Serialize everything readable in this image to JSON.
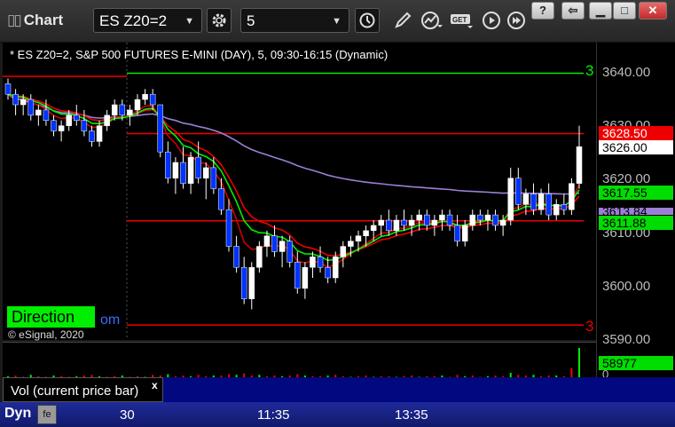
{
  "app": {
    "title": "Chart"
  },
  "toolbar": {
    "symbol": "ES Z20=2",
    "interval": "5",
    "buttons": [
      "settings-icon",
      "clock-icon",
      "pencil-icon",
      "study-icon",
      "get-icon",
      "play-icon",
      "forward-icon"
    ],
    "window": {
      "restore": "?",
      "dock": "⇦",
      "minimize": "▁",
      "maximize": "□",
      "close": "✕"
    }
  },
  "chart": {
    "title": "* ES Z20=2, S&P 500 FUTURES E-MINI (DAY), 5, 09:30-16:15 (Dynamic)",
    "direction_label": "Direction",
    "ghost_label": "om",
    "copyright": "© eSignal, 2020",
    "level_label_top": "3",
    "level_label_bottom": "3",
    "colors": {
      "bg": "#000000",
      "up": "#ffffff",
      "down": "#0033ff",
      "green": "#00ee00",
      "red": "#ee0000",
      "vwap": "#9b7fd6"
    }
  },
  "price_axis": {
    "ticks": [
      "3640.00",
      "3630.00",
      "3620.00",
      "3610.00",
      "3600.00",
      "3590.00"
    ],
    "tags": [
      {
        "text": "3628.50",
        "bg": "#ee0000",
        "fg": "#ffffff"
      },
      {
        "text": "3626.00",
        "bg": "#ffffff",
        "fg": "#000000"
      },
      {
        "text": "3617.55",
        "bg": "#00dd00",
        "fg": "#000000"
      },
      {
        "text": "3613.84",
        "bg": "#9b7fd6",
        "fg": "#000000"
      },
      {
        "text": "3611.88",
        "bg": "#00dd00",
        "fg": "#000000"
      }
    ],
    "hidden_tick": "3610.00"
  },
  "volume": {
    "label": "Vol (current price bar)",
    "close": "x",
    "tag": "58977",
    "zero": "0"
  },
  "time_axis": {
    "labels": [
      "30",
      "11:35",
      "13:35"
    ],
    "dyn": "Dyn",
    "dyn_btn": "fe"
  },
  "chart_data": {
    "type": "candlestick",
    "y_range": [
      3590,
      3645
    ],
    "levels": [
      {
        "name": "green-level",
        "y": 3640.0
      },
      {
        "name": "red-level-upper",
        "y": 3628.5
      },
      {
        "name": "red-level-mid",
        "y": 3611.88
      },
      {
        "name": "red-level-lower",
        "y": 3592.0
      }
    ],
    "candles": [
      [
        3638,
        3639,
        3635,
        3636
      ],
      [
        3636,
        3637,
        3632,
        3634
      ],
      [
        3634,
        3636,
        3632,
        3635
      ],
      [
        3635,
        3636,
        3631,
        3632
      ],
      [
        3632,
        3634,
        3630,
        3633
      ],
      [
        3633,
        3635,
        3630,
        3631
      ],
      [
        3631,
        3632,
        3628,
        3629
      ],
      [
        3629,
        3631,
        3627,
        3630
      ],
      [
        3630,
        3633,
        3629,
        3632
      ],
      [
        3632,
        3634,
        3630,
        3631
      ],
      [
        3631,
        3633,
        3628,
        3629
      ],
      [
        3629,
        3630,
        3626,
        3627
      ],
      [
        3627,
        3631,
        3626,
        3630
      ],
      [
        3630,
        3633,
        3629,
        3632
      ],
      [
        3632,
        3635,
        3631,
        3634
      ],
      [
        3634,
        3635,
        3631,
        3632
      ],
      [
        3632,
        3634,
        3630,
        3633
      ],
      [
        3633,
        3636,
        3632,
        3635
      ],
      [
        3635,
        3637,
        3634,
        3636
      ],
      [
        3636,
        3637,
        3633,
        3634
      ],
      [
        3634,
        3629,
        3624,
        3625
      ],
      [
        3625,
        3627,
        3619,
        3620
      ],
      [
        3620,
        3624,
        3617,
        3623
      ],
      [
        3623,
        3626,
        3618,
        3619
      ],
      [
        3619,
        3625,
        3617,
        3624
      ],
      [
        3624,
        3627,
        3619,
        3620
      ],
      [
        3620,
        3623,
        3616,
        3622
      ],
      [
        3622,
        3624,
        3617,
        3618
      ],
      [
        3618,
        3620,
        3613,
        3614
      ],
      [
        3614,
        3616,
        3606,
        3607
      ],
      [
        3607,
        3609,
        3602,
        3603
      ],
      [
        3603,
        3605,
        3596,
        3597
      ],
      [
        3597,
        3604,
        3595,
        3603
      ],
      [
        3603,
        3608,
        3602,
        3607
      ],
      [
        3607,
        3610,
        3605,
        3609
      ],
      [
        3609,
        3611,
        3605,
        3606
      ],
      [
        3606,
        3609,
        3603,
        3608
      ],
      [
        3608,
        3609,
        3603,
        3604
      ],
      [
        3604,
        3606,
        3598,
        3599
      ],
      [
        3599,
        3604,
        3597,
        3603
      ],
      [
        3603,
        3606,
        3601,
        3605
      ],
      [
        3605,
        3607,
        3602,
        3603
      ],
      [
        3603,
        3605,
        3600,
        3601
      ],
      [
        3601,
        3606,
        3600,
        3605
      ],
      [
        3605,
        3608,
        3603,
        3607
      ],
      [
        3607,
        3609,
        3605,
        3608
      ],
      [
        3608,
        3610,
        3606,
        3609
      ],
      [
        3609,
        3611,
        3607,
        3610
      ],
      [
        3610,
        3612,
        3608,
        3611
      ],
      [
        3611,
        3613,
        3609,
        3612
      ],
      [
        3612,
        3614,
        3609,
        3610
      ],
      [
        3610,
        3613,
        3609,
        3612
      ],
      [
        3612,
        3614,
        3610,
        3611
      ],
      [
        3611,
        3613,
        3609,
        3612
      ],
      [
        3612,
        3614,
        3610,
        3613
      ],
      [
        3613,
        3614,
        3610,
        3611
      ],
      [
        3611,
        3613,
        3609,
        3612
      ],
      [
        3612,
        3614,
        3610,
        3613
      ],
      [
        3613,
        3614,
        3610,
        3611
      ],
      [
        3611,
        3613,
        3607,
        3608
      ],
      [
        3608,
        3612,
        3607,
        3611
      ],
      [
        3611,
        3614,
        3610,
        3613
      ],
      [
        3613,
        3614,
        3611,
        3612
      ],
      [
        3612,
        3614,
        3610,
        3613
      ],
      [
        3613,
        3614,
        3610,
        3611
      ],
      [
        3611,
        3613,
        3609,
        3612
      ],
      [
        3612,
        3622,
        3611,
        3620
      ],
      [
        3620,
        3622,
        3614,
        3615
      ],
      [
        3615,
        3618,
        3613,
        3617
      ],
      [
        3617,
        3619,
        3613,
        3614
      ],
      [
        3614,
        3618,
        3613,
        3617
      ],
      [
        3617,
        3619,
        3612,
        3613
      ],
      [
        3613,
        3616,
        3612,
        3615
      ],
      [
        3615,
        3617,
        3613,
        3614
      ],
      [
        3614,
        3620,
        3613,
        3619
      ],
      [
        3619,
        3630,
        3618,
        3626
      ]
    ],
    "volume": [
      3,
      4,
      2,
      5,
      3,
      2,
      4,
      3,
      2,
      3,
      4,
      5,
      3,
      2,
      3,
      4,
      2,
      3,
      2,
      5,
      4,
      6,
      3,
      4,
      3,
      5,
      3,
      4,
      4,
      6,
      5,
      7,
      4,
      5,
      3,
      4,
      3,
      4,
      6,
      4,
      3,
      3,
      4,
      5,
      3,
      2,
      3,
      4,
      2,
      3,
      3,
      2,
      3,
      4,
      2,
      3,
      3,
      4,
      2,
      5,
      3,
      4,
      2,
      3,
      4,
      3,
      8,
      5,
      4,
      5,
      3,
      4,
      4,
      3,
      15,
      45
    ]
  }
}
